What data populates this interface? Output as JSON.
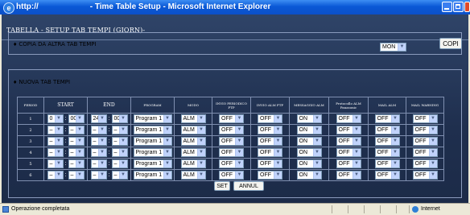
{
  "window": {
    "title": "http://            - Time Table Setup - Microsoft Internet Explorer",
    "ie_icon": "ie-icon",
    "buttons": [
      "minimize-icon",
      "maximize-icon",
      "close-icon"
    ]
  },
  "page": {
    "title": "TABELLA  - SETUP TAB TEMPI (GIORN)-",
    "copy_section": {
      "label": "COPIA DA ALTRA TAB TEMPI",
      "day_value": "MON",
      "copy_button": "COPI"
    },
    "new_section": {
      "label": "NUOVA TAB TEMPI"
    }
  },
  "table": {
    "headers": {
      "period": "PERIOD",
      "start": "START",
      "end": "END",
      "program": "PROGRAM",
      "modo": "MODO",
      "invio_periodico": "INVIO PERIODICO FTP",
      "invio_alm": "INVIO ALM FTP",
      "messaggio": "MESSAGGIO ALM",
      "protocollo": "Protocollo ALM Panasonic",
      "mail_alm": "MAIL ALM",
      "mail_warning": "MAIL WARNING"
    },
    "rows": [
      {
        "period": "1",
        "sh": "0",
        "sm": "00",
        "eh": "24",
        "em": "00",
        "program": "Program 1",
        "modo": "ALM",
        "ipf": "OFF",
        "iaf": "OFF",
        "msg": "ON",
        "prot": "OFF",
        "mail": "OFF",
        "warn": "OFF"
      },
      {
        "period": "2",
        "sh": "–",
        "sm": "–",
        "eh": "–",
        "em": "–",
        "program": "Program 1",
        "modo": "ALM",
        "ipf": "OFF",
        "iaf": "OFF",
        "msg": "ON",
        "prot": "OFF",
        "mail": "OFF",
        "warn": "OFF"
      },
      {
        "period": "3",
        "sh": "–",
        "sm": "–",
        "eh": "–",
        "em": "–",
        "program": "Program 1",
        "modo": "ALM",
        "ipf": "OFF",
        "iaf": "OFF",
        "msg": "ON",
        "prot": "OFF",
        "mail": "OFF",
        "warn": "OFF"
      },
      {
        "period": "4",
        "sh": "–",
        "sm": "–",
        "eh": "–",
        "em": "–",
        "program": "Program 1",
        "modo": "ALM",
        "ipf": "OFF",
        "iaf": "OFF",
        "msg": "ON",
        "prot": "OFF",
        "mail": "OFF",
        "warn": "OFF"
      },
      {
        "period": "5",
        "sh": "–",
        "sm": "–",
        "eh": "–",
        "em": "–",
        "program": "Program 1",
        "modo": "ALM",
        "ipf": "OFF",
        "iaf": "OFF",
        "msg": "ON",
        "prot": "OFF",
        "mail": "OFF",
        "warn": "OFF"
      },
      {
        "period": "6",
        "sh": "–",
        "sm": "–",
        "eh": "–",
        "em": "–",
        "program": "Program 1",
        "modo": "ALM",
        "ipf": "OFF",
        "iaf": "OFF",
        "msg": "ON",
        "prot": "OFF",
        "mail": "OFF",
        "warn": "OFF"
      }
    ]
  },
  "buttons": {
    "set": "SET",
    "annul": "ANNUL"
  },
  "status": {
    "text": "Operazione completata",
    "zone": "Internet"
  },
  "colors": {
    "page_bg": "#1f2f4e",
    "titlebar": "#0a58d6",
    "dropdown_arrow": "#c1d3fb"
  }
}
